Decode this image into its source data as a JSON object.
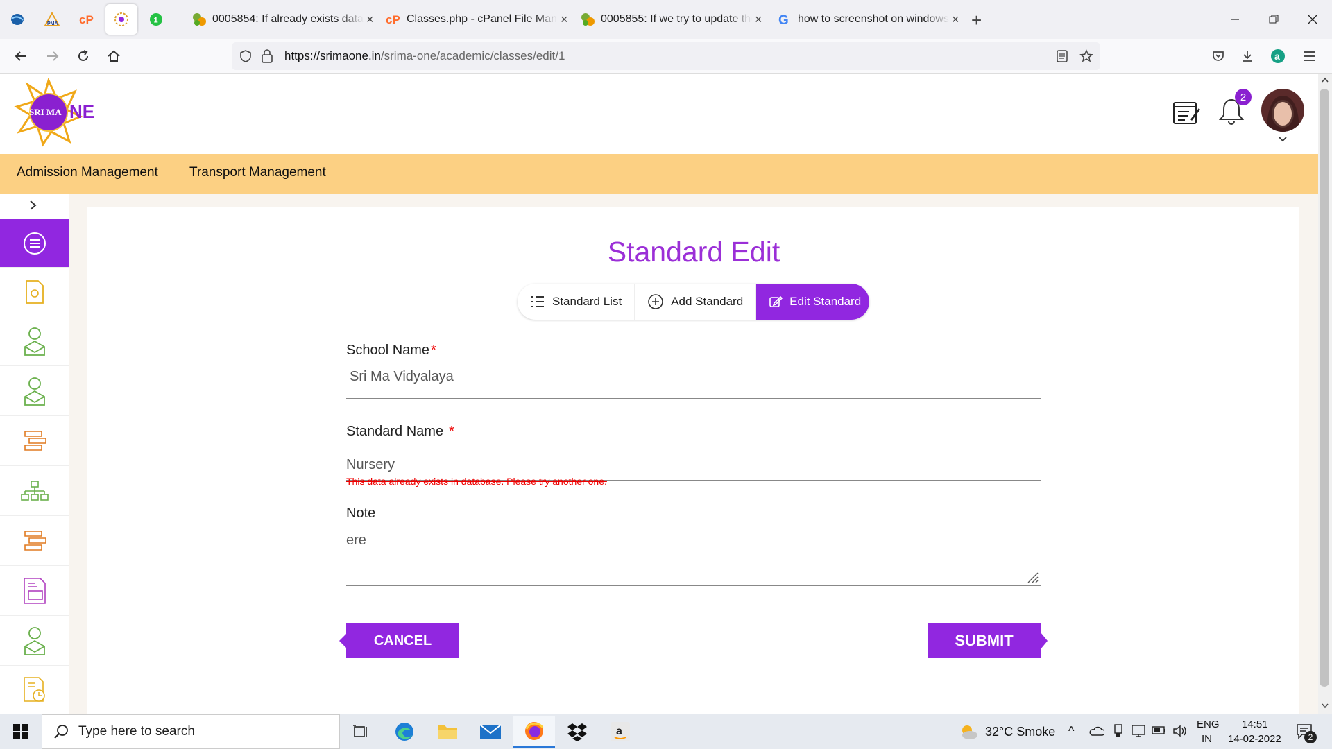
{
  "browser": {
    "tabs": [
      {
        "label": "0005854: If already exists data i"
      },
      {
        "label": "Classes.php - cPanel File Manag"
      },
      {
        "label": "0005855: If we try to update the"
      },
      {
        "label": "how to screenshot on windows"
      }
    ],
    "url_domain": "https://srimaone.in",
    "url_path": "/srima-one/academic/classes/edit/1"
  },
  "app": {
    "logo_text": "SRI MA",
    "logo_suffix": "NE",
    "notification_count": "2",
    "menu": [
      "Admission Management",
      "Transport Management"
    ]
  },
  "page": {
    "title": "Standard Edit",
    "tabs": [
      "Standard List",
      "Add Standard",
      "Edit Standard"
    ],
    "fields": {
      "school_label": "School Name",
      "school_value": "Sri Ma Vidyalaya",
      "standard_label": "Standard Name",
      "standard_value": "Nursery",
      "error": "This data already exists in database. Please try another one.",
      "note_label": "Note",
      "note_value": "ere",
      "required_mark": "*"
    },
    "cancel_label": "CANCEL",
    "submit_label": "SUBMIT"
  },
  "taskbar": {
    "search_placeholder": "Type here to search",
    "weather": "32°C  Smoke",
    "lang1": "ENG",
    "lang2": "IN",
    "time": "14:51",
    "date": "14-02-2022",
    "notif_count": "2"
  },
  "colors": {
    "accent": "#9127e0",
    "menubar": "#fcd083",
    "title": "#9b2fd7",
    "error": "#e00000"
  }
}
